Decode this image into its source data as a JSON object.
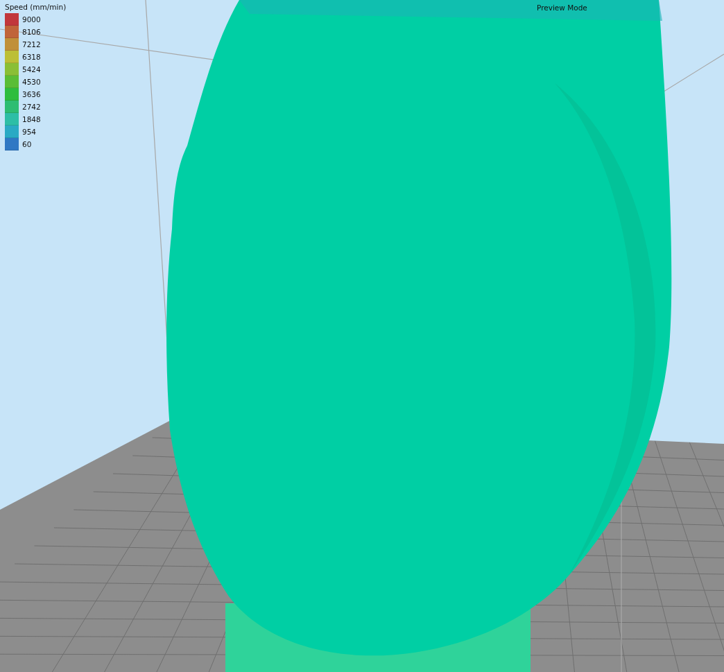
{
  "viewport": {
    "mode_label": "Preview Mode"
  },
  "legend": {
    "title": "Speed (mm/min)",
    "items": [
      {
        "label": "9000",
        "color": "#c1373c"
      },
      {
        "label": "8106",
        "color": "#c0643a"
      },
      {
        "label": "7212",
        "color": "#c0903a"
      },
      {
        "label": "6318",
        "color": "#bcbf36"
      },
      {
        "label": "5424",
        "color": "#8abf36"
      },
      {
        "label": "4530",
        "color": "#5abd36"
      },
      {
        "label": "3636",
        "color": "#2ebd3e"
      },
      {
        "label": "2742",
        "color": "#2dbd72"
      },
      {
        "label": "1848",
        "color": "#2dbea6"
      },
      {
        "label": "954",
        "color": "#2aaac4"
      },
      {
        "label": "60",
        "color": "#2f78c4"
      }
    ]
  }
}
